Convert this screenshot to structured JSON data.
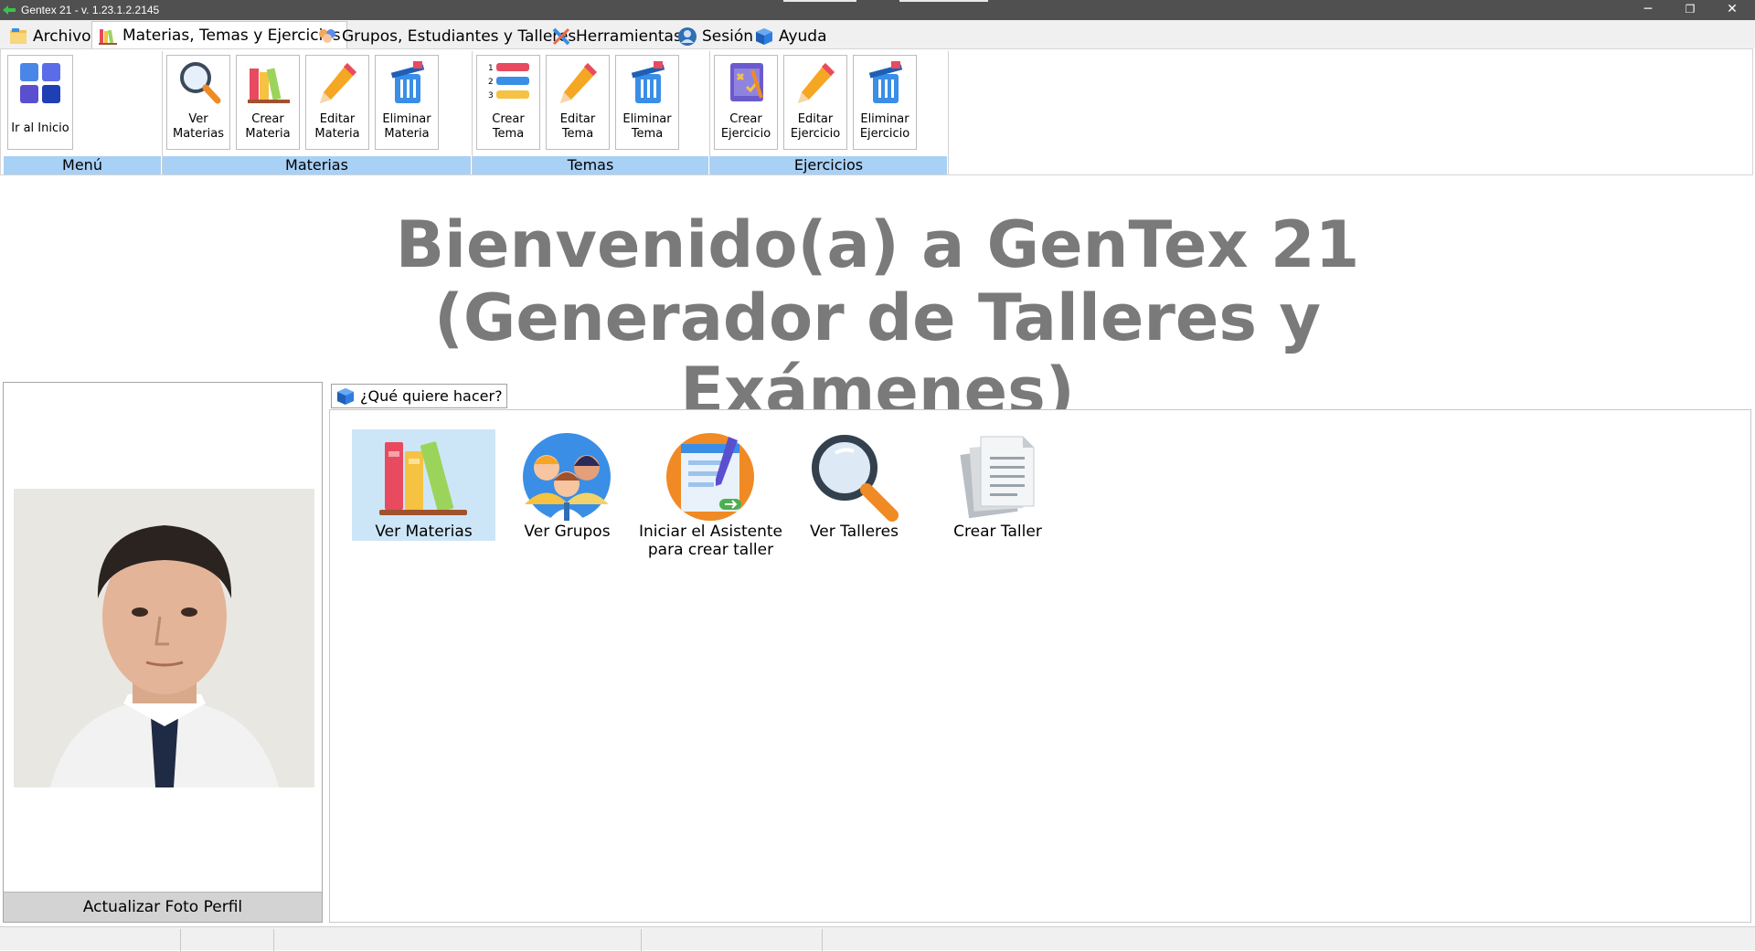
{
  "window": {
    "title": "Gentex 21 - v. 1.23.1.2.2145",
    "controls": {
      "minimize": "─",
      "restore": "❐",
      "close": "✕"
    }
  },
  "menu_tabs": [
    {
      "label": "Archivo",
      "icon": "folder-icon"
    },
    {
      "label": "Materias, Temas y Ejercicios",
      "icon": "books-icon",
      "active": true
    },
    {
      "label": "Grupos, Estudiantes y Talleres",
      "icon": "people-icon"
    },
    {
      "label": "Herramientas",
      "icon": "tools-icon"
    },
    {
      "label": "Sesión",
      "icon": "user-icon"
    },
    {
      "label": "Ayuda",
      "icon": "cube-icon"
    }
  ],
  "ribbon": {
    "menu": {
      "label": "Menú",
      "buttons": [
        {
          "label": "Ir al Inicio",
          "icon": "home-tiles-icon"
        }
      ]
    },
    "materias": {
      "label": "Materias",
      "buttons": [
        {
          "label": "Ver\nMaterias",
          "icon": "magnifier-icon"
        },
        {
          "label": "Crear\nMateria",
          "icon": "books-icon"
        },
        {
          "label": "Editar\nMateria",
          "icon": "pencil-icon"
        },
        {
          "label": "Eliminar\nMateria",
          "icon": "trash-icon"
        }
      ]
    },
    "temas": {
      "label": "Temas",
      "buttons": [
        {
          "label": "Crear\nTema",
          "icon": "numbered-list-icon"
        },
        {
          "label": "Editar\nTema",
          "icon": "pencil-icon"
        },
        {
          "label": "Eliminar\nTema",
          "icon": "trash-icon"
        }
      ]
    },
    "ejercicios": {
      "label": "Ejercicios",
      "buttons": [
        {
          "label": "Crear\nEjercicio",
          "icon": "exercise-board-icon"
        },
        {
          "label": "Editar\nEjercicio",
          "icon": "pencil-icon"
        },
        {
          "label": "Eliminar\nEjercicio",
          "icon": "trash-icon"
        }
      ]
    }
  },
  "welcome": {
    "line1": "Bienvenido(a) a GenTex 21",
    "line2": "(Generador de Talleres y Exámenes)",
    "color": "#7a7a7a"
  },
  "profile": {
    "update_photo_label": "Actualizar Foto Perfil"
  },
  "actions": {
    "header": "¿Qué quiere hacer?",
    "items": [
      {
        "label": "Ver Materias",
        "icon": "books-icon",
        "selected": true
      },
      {
        "label": "Ver Grupos",
        "icon": "group-avatars-icon"
      },
      {
        "label": "Iniciar el Asistente\npara crear taller",
        "icon": "wizard-document-icon"
      },
      {
        "label": "Ver Talleres",
        "icon": "magnifier-icon"
      },
      {
        "label": "Crear Taller",
        "icon": "documents-icon"
      }
    ]
  },
  "colors": {
    "titlebar": "#505050",
    "group_label_bg": "#a9d0f5",
    "selection": "#cde6f7"
  }
}
